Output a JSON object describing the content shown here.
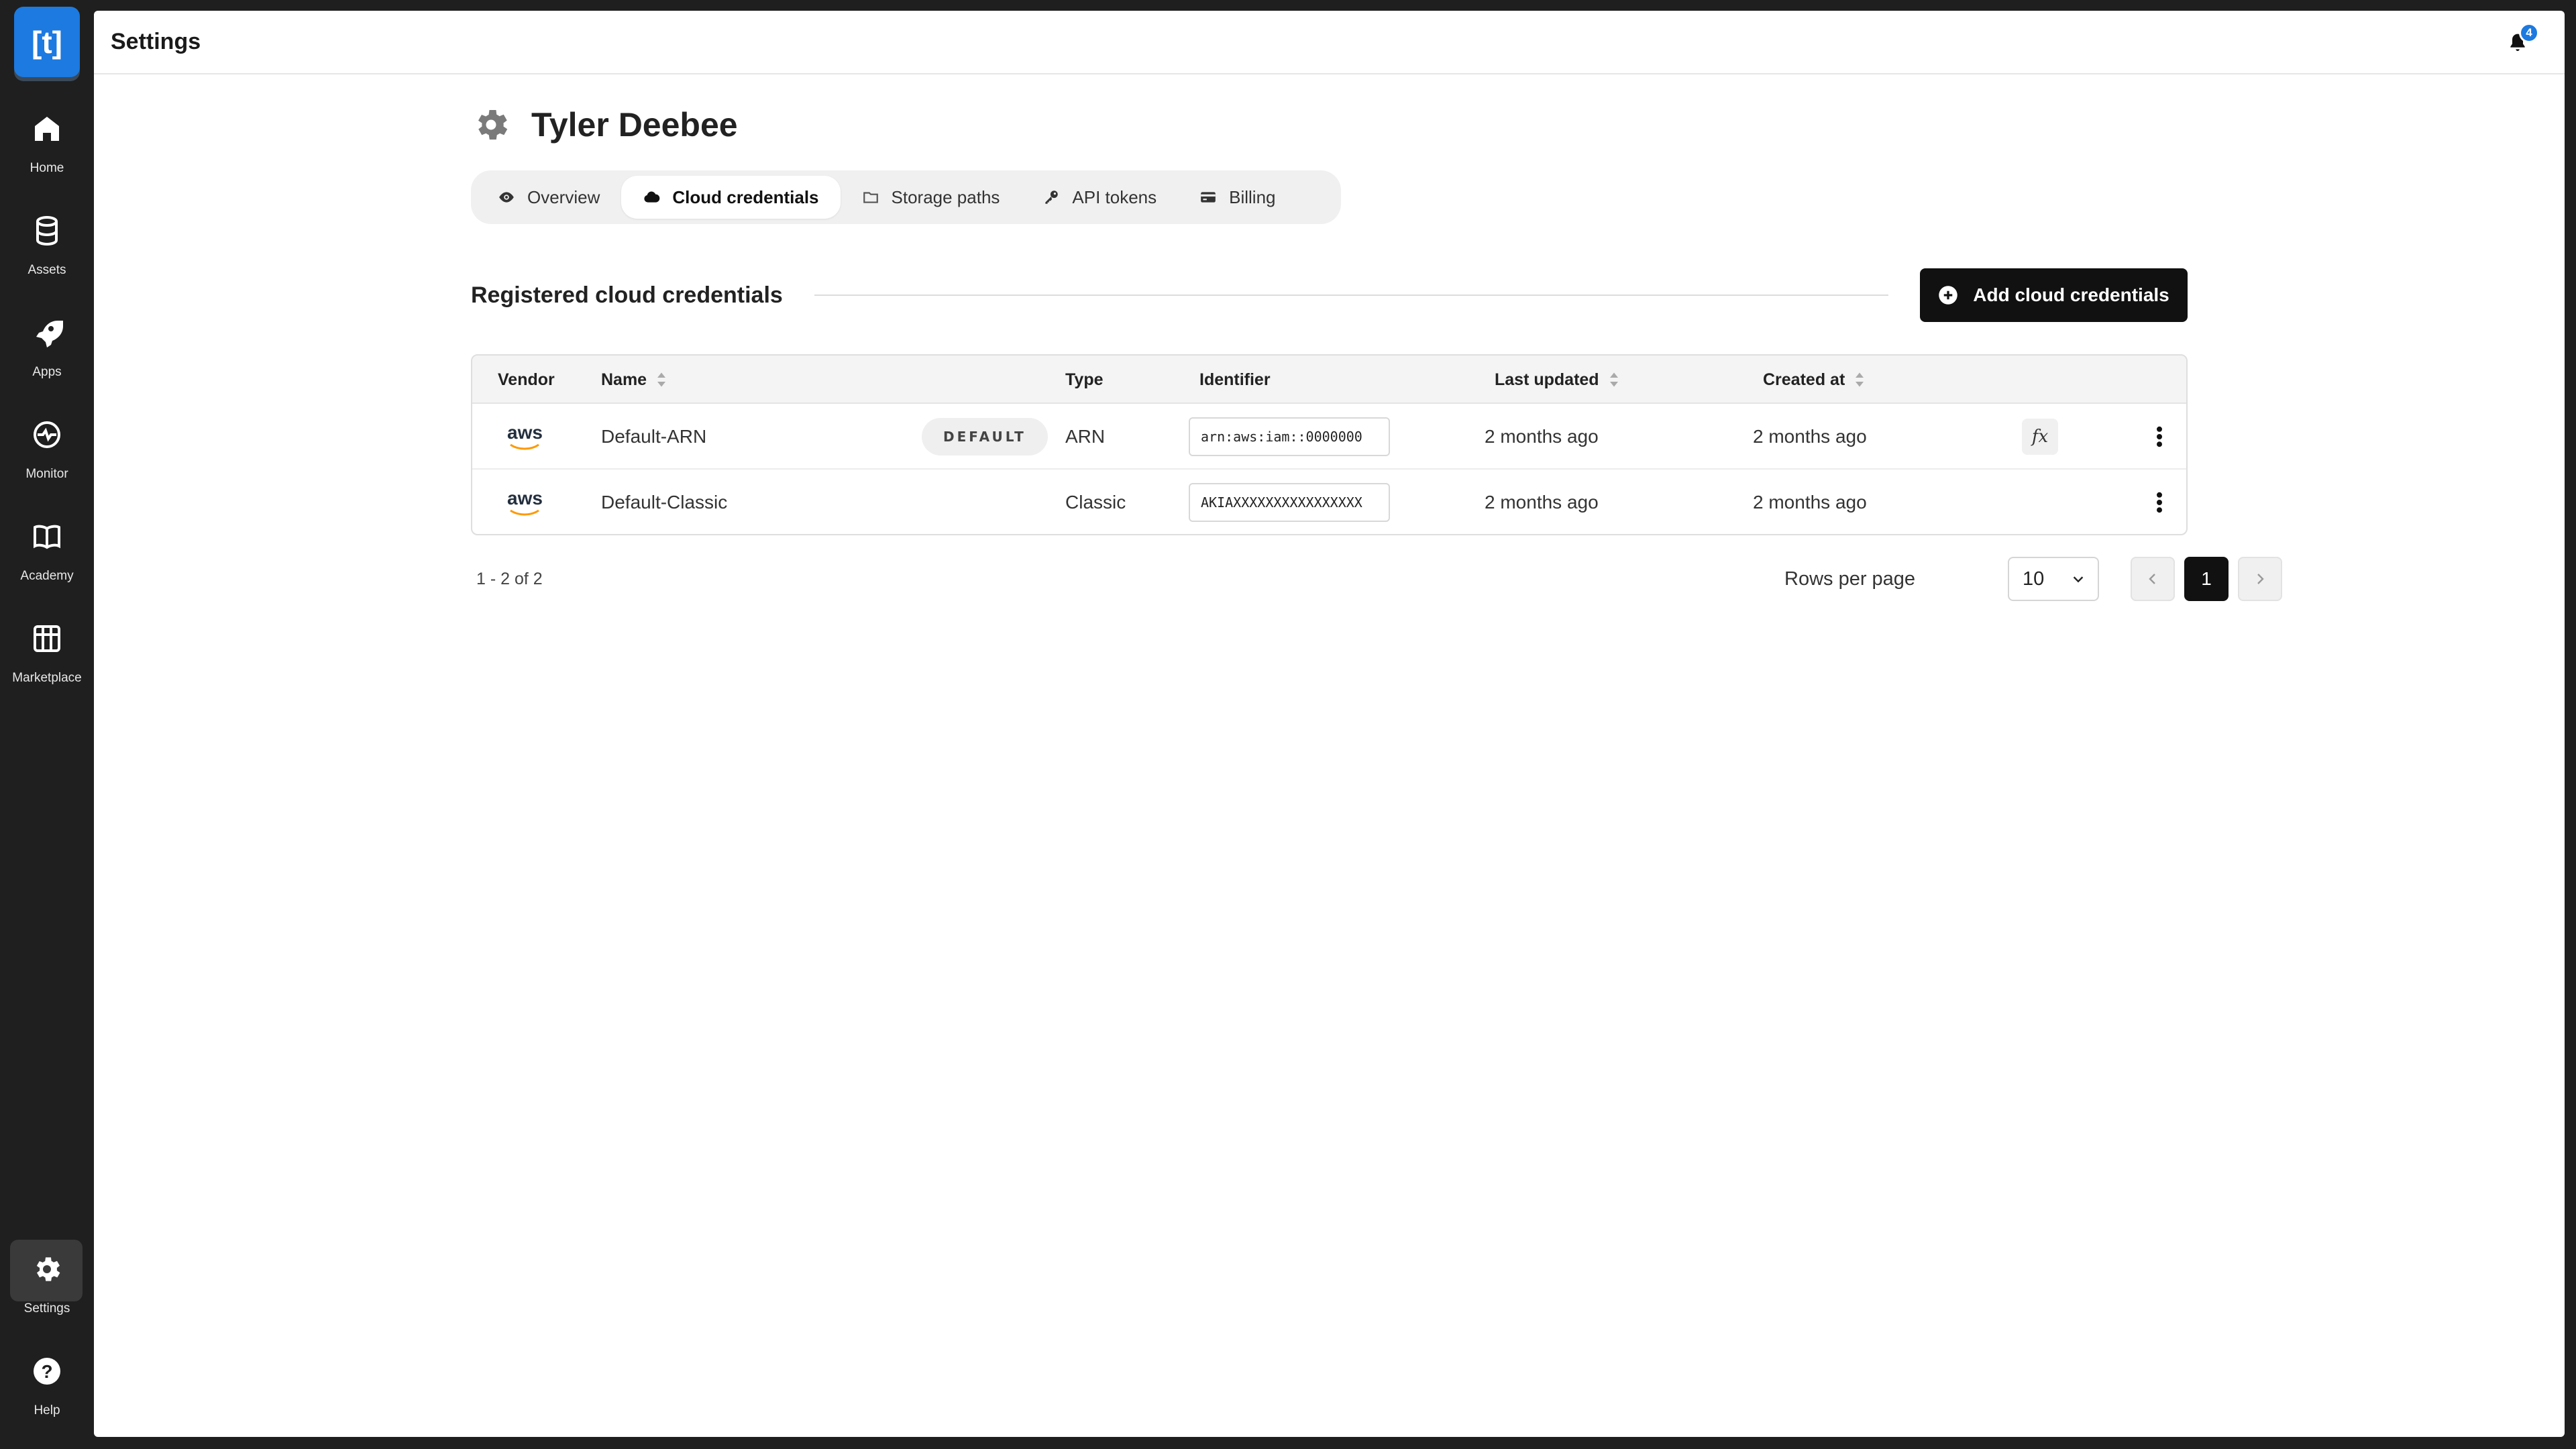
{
  "app": {
    "logo_text": "[t]",
    "accent": "#1c7ae0"
  },
  "sidebar": {
    "items": [
      {
        "label": "Home",
        "icon": "home-icon"
      },
      {
        "label": "Assets",
        "icon": "database-icon"
      },
      {
        "label": "Apps",
        "icon": "rocket-icon"
      },
      {
        "label": "Monitor",
        "icon": "pulse-icon"
      },
      {
        "label": "Academy",
        "icon": "book-icon"
      },
      {
        "label": "Marketplace",
        "icon": "store-icon"
      }
    ],
    "bottom": [
      {
        "label": "Settings",
        "icon": "gear-icon",
        "active": true
      },
      {
        "label": "Help",
        "icon": "help-icon"
      }
    ]
  },
  "header": {
    "title": "Settings",
    "notifications": "4"
  },
  "page": {
    "title": "Tyler Deebee"
  },
  "tabs": [
    {
      "label": "Overview",
      "icon": "eye-icon"
    },
    {
      "label": "Cloud credentials",
      "icon": "cloud-icon",
      "active": true
    },
    {
      "label": "Storage paths",
      "icon": "folder-icon"
    },
    {
      "label": "API tokens",
      "icon": "key-icon"
    },
    {
      "label": "Billing",
      "icon": "credit-card-icon"
    }
  ],
  "section": {
    "title": "Registered cloud credentials",
    "add_button": "Add cloud credentials"
  },
  "table": {
    "columns": [
      "Vendor",
      "Name",
      "Type",
      "Identifier",
      "Last updated",
      "Created at"
    ],
    "rows": [
      {
        "vendor": "aws",
        "name": "Default-ARN",
        "badge": "DEFAULT",
        "type": "ARN",
        "identifier": "arn:aws:iam::0000000",
        "last_updated": "2 months ago",
        "created_at": "2 months ago"
      },
      {
        "vendor": "aws",
        "name": "Default-Classic",
        "badge": "",
        "type": "Classic",
        "identifier": "AKIAXXXXXXXXXXXXXXXX",
        "last_updated": "2 months ago",
        "created_at": "2 months ago"
      }
    ]
  },
  "pagination": {
    "range": "1 - 2 of 2",
    "rows_per_page_label": "Rows per page",
    "rows_per_page": "10",
    "current_page": "1"
  }
}
